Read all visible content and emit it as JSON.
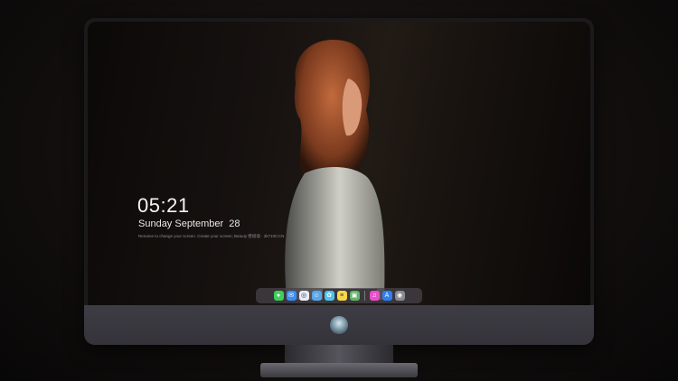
{
  "lock_screen": {
    "time": "05:21",
    "date": "Sunday September  28",
    "notice": "Rename to change your screen. Create your screen; Beauty 壁纸墙 · 3k7100.CN"
  },
  "dock": {
    "apps": [
      {
        "name": "messages-icon",
        "color": "#3fce5a",
        "glyph": "●"
      },
      {
        "name": "mail-icon",
        "color": "#3a8ef6",
        "glyph": "✉"
      },
      {
        "name": "safari-icon",
        "color": "#e9eef5",
        "glyph": "◎"
      },
      {
        "name": "finder-icon",
        "color": "#5aa7e8",
        "glyph": "☺"
      },
      {
        "name": "photos-icon",
        "color": "#4fc3f0",
        "glyph": "✿"
      },
      {
        "name": "notes-icon",
        "color": "#f7d74a",
        "glyph": "≡"
      },
      {
        "name": "preview-icon",
        "color": "#63b36a",
        "glyph": "▣"
      },
      {
        "name": "music-icon",
        "color": "#ea4fc9",
        "glyph": "♫"
      },
      {
        "name": "app-store-icon",
        "color": "#2f7ff0",
        "glyph": "A"
      },
      {
        "name": "camera-icon",
        "color": "#8a8a90",
        "glyph": "◉"
      }
    ]
  }
}
